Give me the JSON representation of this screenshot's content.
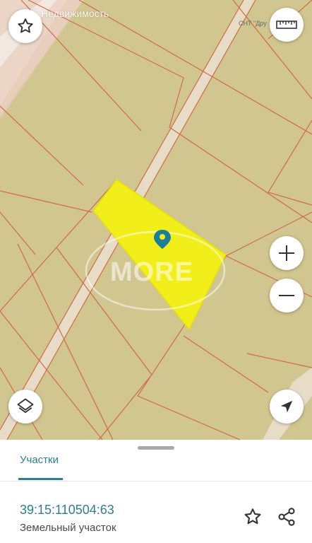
{
  "map": {
    "brand_text": "Недвижимость",
    "snt_label": "СНТ \"Дру",
    "watermark": "MORE"
  },
  "controls": {
    "favorite": "star-outline-icon",
    "ruler": "ruler-icon",
    "zoom_in": "plus-icon",
    "zoom_out": "minus-icon",
    "layers": "layers-icon",
    "locate": "navigation-arrow-icon"
  },
  "sheet": {
    "tab_label": "Участки",
    "cadastral_number": "39:15:110504:63",
    "parcel_type": "Земельный участок"
  },
  "colors": {
    "map_background": "#d1c68f",
    "parcel_lines": "#d06a4a",
    "selected_parcel": "#f2ee1a",
    "accent": "#2d7f8f"
  }
}
